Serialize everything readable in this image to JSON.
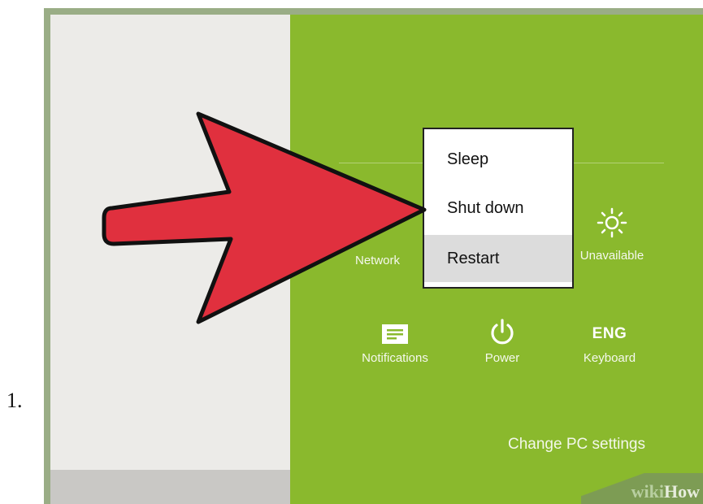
{
  "list_marker": "1.",
  "power_menu": {
    "items": [
      {
        "label": "Sleep",
        "selected": false
      },
      {
        "label": "Shut down",
        "selected": false
      },
      {
        "label": "Restart",
        "selected": true
      }
    ]
  },
  "settings_tiles": {
    "row1": [
      {
        "label": "Network",
        "icon": "network-icon"
      },
      {
        "label": "Unavailable",
        "icon": "brightness-icon"
      }
    ],
    "row2": [
      {
        "label": "Notifications",
        "icon": "notifications-icon"
      },
      {
        "label": "Power",
        "icon": "power-icon"
      },
      {
        "label": "Keyboard",
        "icon": "keyboard-icon",
        "icon_text": "ENG"
      }
    ]
  },
  "change_pc_settings": "Change PC settings",
  "watermark": {
    "prefix": "wiki",
    "suffix": "How"
  },
  "colors": {
    "green_panel": "#8ab92d",
    "left_panel": "#ecebe8",
    "arrow_fill": "#e0303e",
    "menu_selected": "#dcdcdc"
  }
}
